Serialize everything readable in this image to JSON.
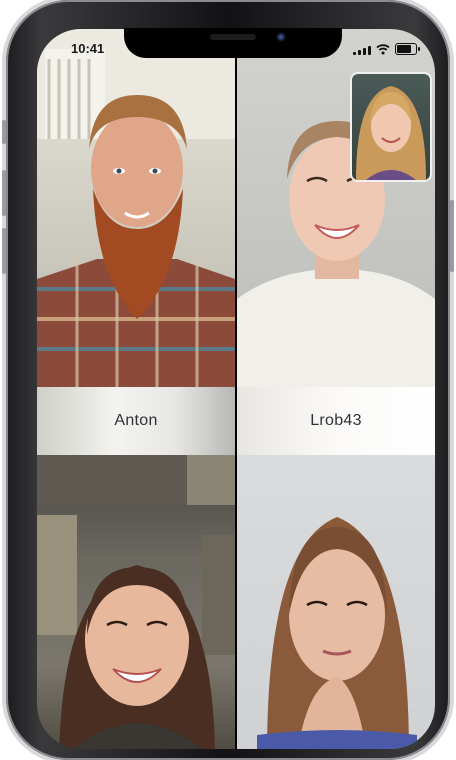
{
  "status_bar": {
    "time": "10:41",
    "battery_level": 0.85,
    "signal_bars": 4
  },
  "participants": [
    {
      "name": "Anton"
    },
    {
      "name": "Lrob43"
    },
    {
      "name": ""
    },
    {
      "name": ""
    }
  ],
  "self_view": {
    "icon": "self-camera-preview"
  },
  "colors": {
    "name_text": "#2d3138",
    "phone_frame": "#1c1c1e"
  }
}
